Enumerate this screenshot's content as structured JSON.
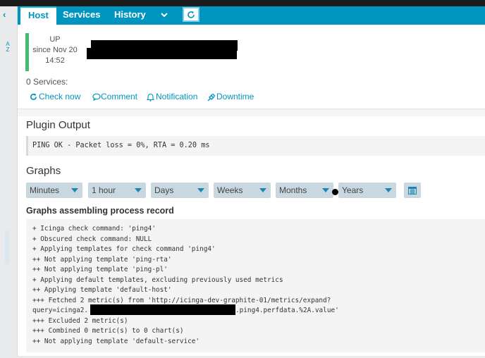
{
  "tabs": {
    "host": "Host",
    "services": "Services",
    "history": "History"
  },
  "icons": {
    "collapse": "chevron-left-icon",
    "sort": "sort-az-icon",
    "more": "chevron-down-icon",
    "refresh": "refresh-icon",
    "check_now": "refresh-icon",
    "comment": "comment-icon",
    "notification": "bell-icon",
    "downtime": "plug-icon",
    "calendar": "calendar-icon"
  },
  "host": {
    "state": "UP",
    "since_line1": "since Nov 20",
    "since_line2": "14:52",
    "status_color": "#44bb77"
  },
  "services_count": "0 Services:",
  "actions": {
    "check_now": "Check now",
    "comment": "Comment",
    "notification": "Notification",
    "downtime": "Downtime"
  },
  "plugin": {
    "heading": "Plugin Output",
    "output": "PING OK - Packet loss = 0%, RTA = 0.20 ms"
  },
  "graphs": {
    "heading": "Graphs",
    "selects": [
      "Minutes",
      "1 hour",
      "Days",
      "Weeks",
      "Months",
      "Years"
    ]
  },
  "assembly": {
    "heading": "Graphs assembling process record",
    "lines": [
      "+ Icinga check command: 'ping4'",
      "+ Obscured check command: NULL",
      "+ Applying templates for check command 'ping4'",
      "++ Not applying template 'ping-rta'",
      "++ Not applying template 'ping-pl'",
      "+ Applying default templates, excluding previously used metrics",
      "++ Applying template 'default-host'",
      "+++ Fetched 2 metric(s) from 'http://icinga-dev-graphite-01/metrics/expand?",
      "query=icinga2.",
      ".ping4.perfdata.%2A.value'",
      "+++ Excluded 2 metric(s)",
      "+++ Combined 0 metric(s) to 0 chart(s)",
      "++ Not applying template 'default-service'"
    ]
  },
  "colors": {
    "accent": "#0095bf",
    "up": "#44bb77",
    "select_bg": "#c9d8e0"
  }
}
